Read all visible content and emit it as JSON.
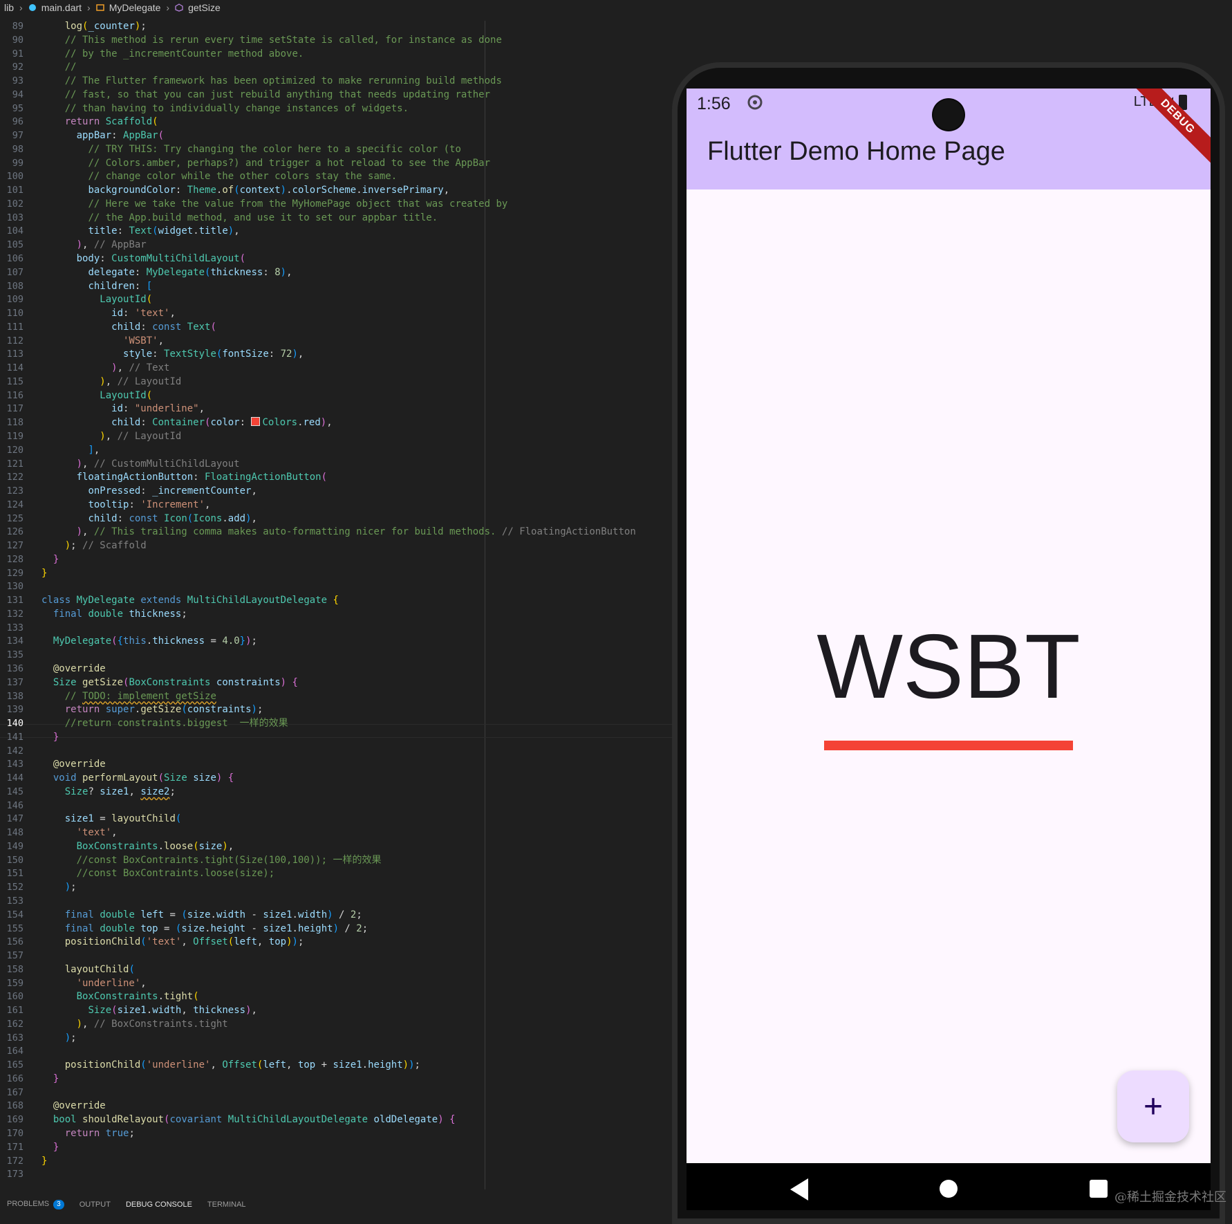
{
  "breadcrumb": {
    "root": "lib",
    "file": "main.dart",
    "class": "MyDelegate",
    "method": "getSize"
  },
  "editor": {
    "active_line": 140
  },
  "status_tabs": {
    "problems": "PROBLEMS",
    "problems_count": "3",
    "output": "OUTPUT",
    "debug_console": "DEBUG CONSOLE",
    "terminal": "TERMINAL"
  },
  "emulator": {
    "time": "1:56",
    "network": "LTE",
    "debug_banner": "DEBUG",
    "app_title": "Flutter Demo Home Page",
    "body_text": "WSBT",
    "fab_label": "+"
  },
  "watermark": "@稀土掘金技术社区",
  "colors": {
    "appbar": "#d3bcfd",
    "underline": "#f44336",
    "fab": "#eddcff",
    "editor_bg": "#1f1f1f"
  }
}
